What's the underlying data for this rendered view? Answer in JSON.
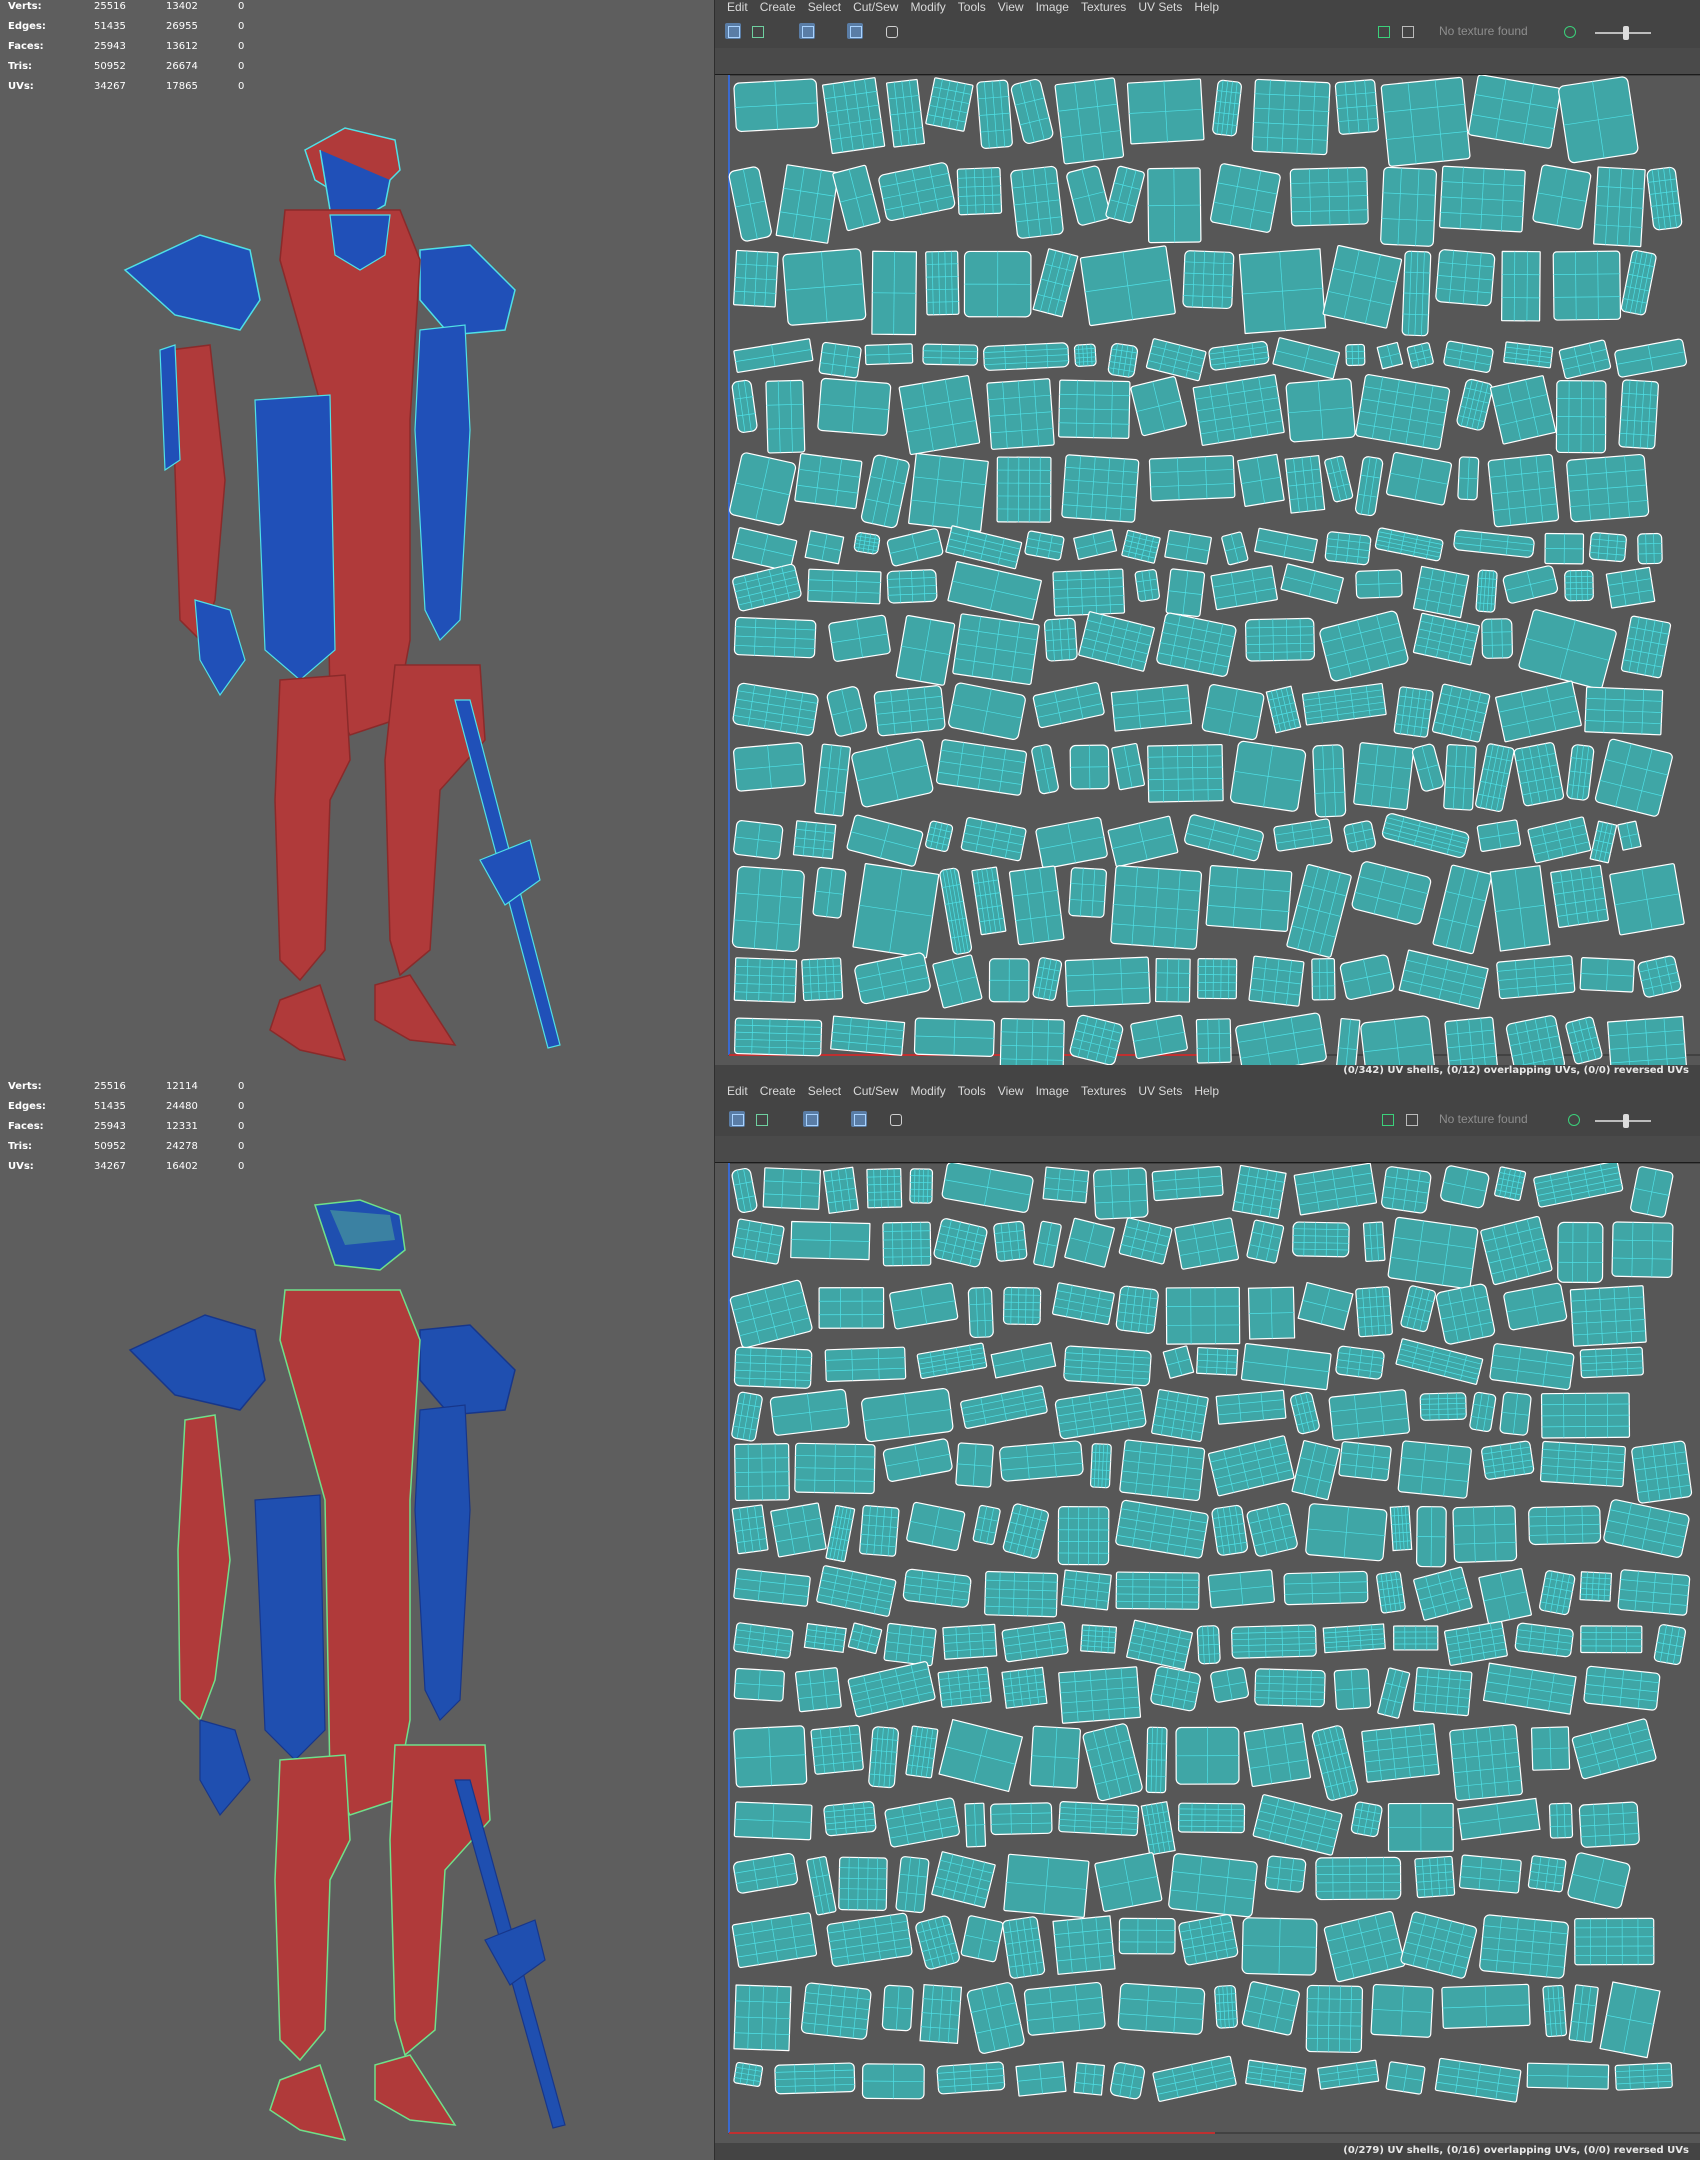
{
  "top": {
    "stats": [
      {
        "label": "Verts:",
        "v1": "25516",
        "v2": "13402",
        "v3": "0"
      },
      {
        "label": "Edges:",
        "v1": "51435",
        "v2": "26955",
        "v3": "0"
      },
      {
        "label": "Faces:",
        "v1": "25943",
        "v2": "13612",
        "v3": "0"
      },
      {
        "label": "Tris:",
        "v1": "50952",
        "v2": "26674",
        "v3": "0"
      },
      {
        "label": "UVs:",
        "v1": "34267",
        "v2": "17865",
        "v3": "0"
      }
    ],
    "menu": [
      "Edit",
      "Create",
      "Select",
      "Cut/Sew",
      "Modify",
      "Tools",
      "View",
      "Image",
      "Textures",
      "UV Sets",
      "Help"
    ],
    "texture_status": "No texture found",
    "status": "(0/342) UV shells, (0/12) overlapping UVs, (0/0) reversed UVs"
  },
  "bottom": {
    "stats": [
      {
        "label": "Verts:",
        "v1": "25516",
        "v2": "12114",
        "v3": "0"
      },
      {
        "label": "Edges:",
        "v1": "51435",
        "v2": "24480",
        "v3": "0"
      },
      {
        "label": "Faces:",
        "v1": "25943",
        "v2": "12331",
        "v3": "0"
      },
      {
        "label": "Tris:",
        "v1": "50952",
        "v2": "24278",
        "v3": "0"
      },
      {
        "label": "UVs:",
        "v1": "34267",
        "v2": "16402",
        "v3": "0"
      }
    ],
    "menu": [
      "Edit",
      "Create",
      "Select",
      "Cut/Sew",
      "Modify",
      "Tools",
      "View",
      "Image",
      "Textures",
      "UV Sets",
      "Help"
    ],
    "texture_status": "No texture found",
    "status": "(0/279) UV shells, (0/16) overlapping UVs, (0/0) reversed UVs"
  },
  "colors": {
    "viewport_bg": "#5e5e5e",
    "uv_shell_fill": "#3fa6a6",
    "uv_wire": "#4fe0e6",
    "model_red": "#b03a3a",
    "model_blue": "#1f4fb0",
    "wire_green": "#6fe08a"
  },
  "icons": [
    "uv-editor-icon",
    "checker-icon",
    "texture-icon",
    "camera-icon",
    "snapshot-icon"
  ]
}
